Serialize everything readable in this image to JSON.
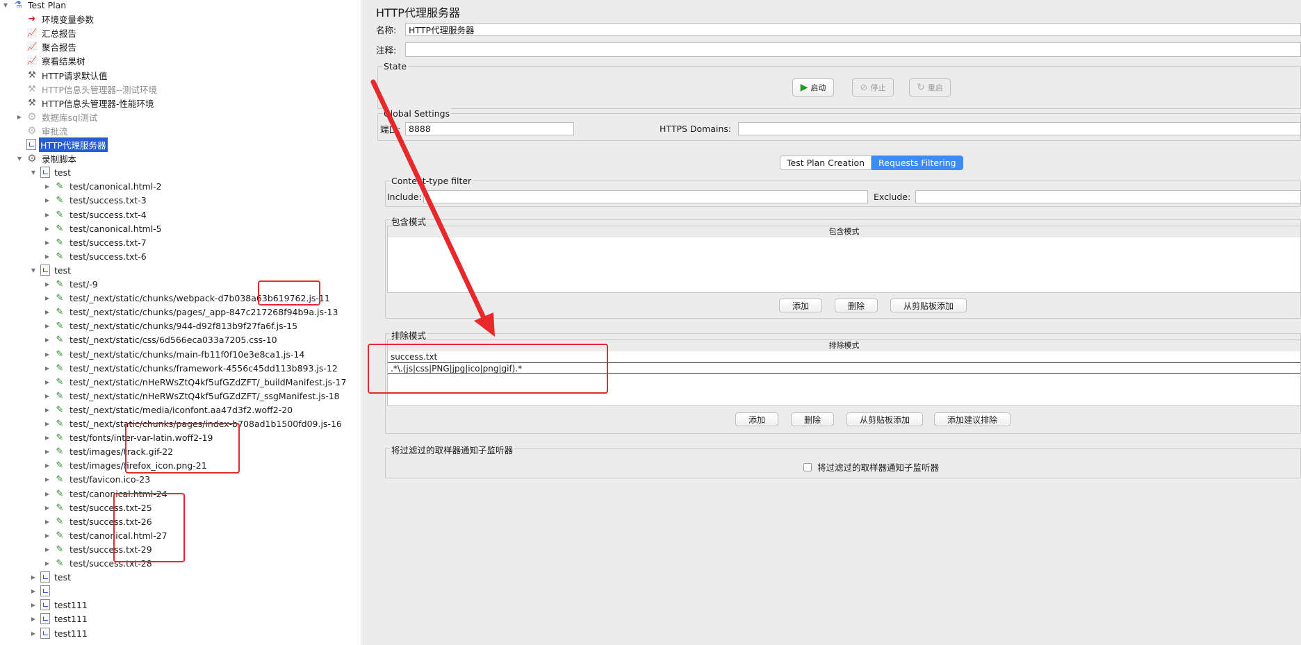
{
  "tree": [
    {
      "label": "Test Plan",
      "icon": "flask-icon",
      "toggle": "open",
      "style": "normal",
      "level": 0
    },
    {
      "label": "环境变量参数",
      "icon": "env-var-icon",
      "toggle": "",
      "style": "normal",
      "level": 1
    },
    {
      "label": "汇总报告",
      "icon": "chart-icon",
      "toggle": "",
      "style": "normal",
      "level": 1
    },
    {
      "label": "聚合报告",
      "icon": "chart-icon",
      "toggle": "",
      "style": "normal",
      "level": 1
    },
    {
      "label": "察看结果树",
      "icon": "chart-icon",
      "toggle": "",
      "style": "normal",
      "level": 1
    },
    {
      "label": "HTTP请求默认值",
      "icon": "tools-icon",
      "toggle": "",
      "style": "normal",
      "level": 1
    },
    {
      "label": "HTTP信息头管理器--测试环境",
      "icon": "tools-icon",
      "toggle": "",
      "style": "disabled",
      "level": 1
    },
    {
      "label": "HTTP信息头管理器-性能环境",
      "icon": "tools-icon",
      "toggle": "",
      "style": "normal",
      "level": 1
    },
    {
      "label": "数据库sql测试",
      "icon": "gear-icon",
      "toggle": "closed",
      "style": "disabled",
      "level": 1
    },
    {
      "label": "审批流",
      "icon": "gear-icon",
      "toggle": "",
      "style": "disabled",
      "level": 1
    },
    {
      "label": "HTTP代理服务器",
      "icon": "doc-icon",
      "toggle": "",
      "style": "selected",
      "level": 1
    },
    {
      "label": "录制脚本",
      "icon": "gear-icon",
      "toggle": "open",
      "style": "normal",
      "level": 1
    },
    {
      "label": "test",
      "icon": "doc-icon",
      "toggle": "open",
      "style": "normal",
      "level": 2
    },
    {
      "label": "test/canonical.html-2",
      "icon": "pipette-icon",
      "toggle": "closed",
      "style": "normal",
      "level": 3
    },
    {
      "label": "test/success.txt-3",
      "icon": "pipette-icon",
      "toggle": "closed",
      "style": "normal",
      "level": 3
    },
    {
      "label": "test/success.txt-4",
      "icon": "pipette-icon",
      "toggle": "closed",
      "style": "normal",
      "level": 3
    },
    {
      "label": "test/canonical.html-5",
      "icon": "pipette-icon",
      "toggle": "closed",
      "style": "normal",
      "level": 3
    },
    {
      "label": "test/success.txt-7",
      "icon": "pipette-icon",
      "toggle": "closed",
      "style": "normal",
      "level": 3
    },
    {
      "label": "test/success.txt-6",
      "icon": "pipette-icon",
      "toggle": "closed",
      "style": "normal",
      "level": 3
    },
    {
      "label": "test",
      "icon": "doc-icon",
      "toggle": "open",
      "style": "normal",
      "level": 2
    },
    {
      "label": "test/-9",
      "icon": "pipette-icon",
      "toggle": "closed",
      "style": "normal",
      "level": 3
    },
    {
      "label": "test/_next/static/chunks/webpack-d7b038a63b619762.js-11",
      "icon": "pipette-icon",
      "toggle": "closed",
      "style": "normal",
      "level": 3
    },
    {
      "label": "test/_next/static/chunks/pages/_app-847c217268f94b9a.js-13",
      "icon": "pipette-icon",
      "toggle": "closed",
      "style": "normal",
      "level": 3
    },
    {
      "label": "test/_next/static/chunks/944-d92f813b9f27fa6f.js-15",
      "icon": "pipette-icon",
      "toggle": "closed",
      "style": "normal",
      "level": 3
    },
    {
      "label": "test/_next/static/css/6d566eca033a7205.css-10",
      "icon": "pipette-icon",
      "toggle": "closed",
      "style": "normal",
      "level": 3
    },
    {
      "label": "test/_next/static/chunks/main-fb11f0f10e3e8ca1.js-14",
      "icon": "pipette-icon",
      "toggle": "closed",
      "style": "normal",
      "level": 3
    },
    {
      "label": "test/_next/static/chunks/framework-4556c45dd113b893.js-12",
      "icon": "pipette-icon",
      "toggle": "closed",
      "style": "normal",
      "level": 3
    },
    {
      "label": "test/_next/static/nHeRWsZtQ4kf5ufGZdZFT/_buildManifest.js-17",
      "icon": "pipette-icon",
      "toggle": "closed",
      "style": "normal",
      "level": 3
    },
    {
      "label": "test/_next/static/nHeRWsZtQ4kf5ufGZdZFT/_ssgManifest.js-18",
      "icon": "pipette-icon",
      "toggle": "closed",
      "style": "normal",
      "level": 3
    },
    {
      "label": "test/_next/static/media/iconfont.aa47d3f2.woff2-20",
      "icon": "pipette-icon",
      "toggle": "closed",
      "style": "normal",
      "level": 3
    },
    {
      "label": "test/_next/static/chunks/pages/index-b708ad1b1500fd09.js-16",
      "icon": "pipette-icon",
      "toggle": "closed",
      "style": "normal",
      "level": 3
    },
    {
      "label": "test/fonts/inter-var-latin.woff2-19",
      "icon": "pipette-icon",
      "toggle": "closed",
      "style": "normal",
      "level": 3
    },
    {
      "label": "test/images/track.gif-22",
      "icon": "pipette-icon",
      "toggle": "closed",
      "style": "normal",
      "level": 3
    },
    {
      "label": "test/images/firefox_icon.png-21",
      "icon": "pipette-icon",
      "toggle": "closed",
      "style": "normal",
      "level": 3
    },
    {
      "label": "test/favicon.ico-23",
      "icon": "pipette-icon",
      "toggle": "closed",
      "style": "normal",
      "level": 3
    },
    {
      "label": "test/canonical.html-24",
      "icon": "pipette-icon",
      "toggle": "closed",
      "style": "normal",
      "level": 3
    },
    {
      "label": "test/success.txt-25",
      "icon": "pipette-icon",
      "toggle": "closed",
      "style": "normal",
      "level": 3
    },
    {
      "label": "test/success.txt-26",
      "icon": "pipette-icon",
      "toggle": "closed",
      "style": "normal",
      "level": 3
    },
    {
      "label": "test/canonical.html-27",
      "icon": "pipette-icon",
      "toggle": "closed",
      "style": "normal",
      "level": 3
    },
    {
      "label": "test/success.txt-29",
      "icon": "pipette-icon",
      "toggle": "closed",
      "style": "normal",
      "level": 3
    },
    {
      "label": "test/success.txt-28",
      "icon": "pipette-icon",
      "toggle": "closed",
      "style": "normal",
      "level": 3
    },
    {
      "label": "test",
      "icon": "doc-icon",
      "toggle": "closed",
      "style": "normal",
      "level": 2
    },
    {
      "label": "",
      "icon": "doc-icon",
      "toggle": "closed",
      "style": "normal",
      "level": 2
    },
    {
      "label": "test111",
      "icon": "doc-icon",
      "toggle": "closed",
      "style": "normal",
      "level": 2
    },
    {
      "label": "test111",
      "icon": "doc-icon",
      "toggle": "closed",
      "style": "normal",
      "level": 2
    },
    {
      "label": "test111",
      "icon": "doc-icon",
      "toggle": "closed",
      "style": "normal",
      "level": 2
    }
  ],
  "panel": {
    "title": "HTTP代理服务器",
    "name_label": "名称:",
    "name_value": "HTTP代理服务器",
    "comment_label": "注释:",
    "comment_value": "",
    "state": {
      "legend": "State",
      "start_label": "启动",
      "stop_label": "停止",
      "restart_label": "重启"
    },
    "global": {
      "legend": "Global Settings",
      "port_label": "端口:",
      "port_value": "8888",
      "https_label": "HTTPS Domains:",
      "https_value": ""
    },
    "tabs": [
      "Test Plan Creation",
      "Requests Filtering"
    ],
    "content_filter": {
      "legend": "Content-type filter",
      "include_label": "Include:",
      "include_value": "",
      "exclude_label": "Exclude:",
      "exclude_value": ""
    },
    "include_patterns": {
      "legend": "包含模式",
      "column": "包含模式",
      "rows": [],
      "add": "添加",
      "delete": "删除",
      "paste": "从剪贴板添加"
    },
    "exclude_patterns": {
      "legend": "排除模式",
      "column": "排除模式",
      "rows": [
        "success.txt",
        ".*\\.(js|css|PNG|jpg|ico|png|gif).*"
      ],
      "add": "添加",
      "delete": "删除",
      "paste": "从剪贴板添加",
      "suggest": "添加建议排除"
    },
    "notify": {
      "legend": "将过滤过的取样器通知子监听器",
      "checkbox_label": "将过滤过的取样器通知子监听器",
      "checked": false
    }
  },
  "annotation_color": "#e8292b",
  "selection_color": "#2a5bd7",
  "tab_active_color": "#3d8cf6"
}
